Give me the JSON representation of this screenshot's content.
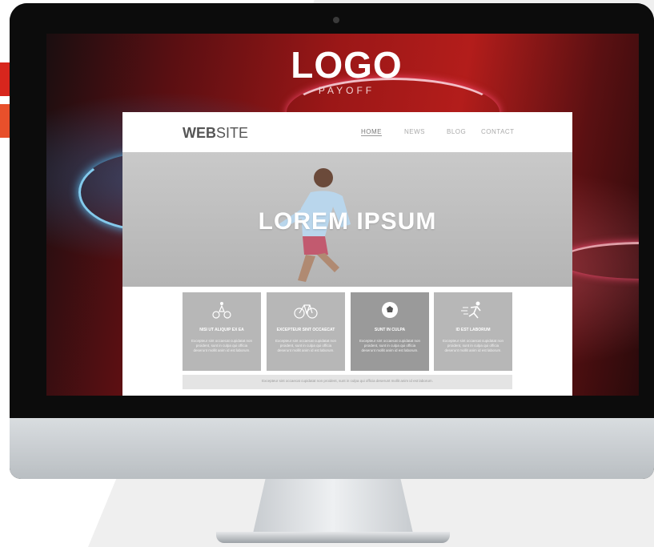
{
  "colors": {
    "accent_red": "#d7261d",
    "accent_orange": "#e8502b",
    "screen_red": "#b31d1b",
    "tile_grey": "#b7b7b7",
    "tile_dark": "#9a9a9a"
  },
  "screen": {
    "logo": "LOGO",
    "payoff": "PAYOFF"
  },
  "site": {
    "brand_bold": "WEB",
    "brand_light": "SITE",
    "nav": [
      "HOME",
      "NEWS",
      "BLOG",
      "CONTACT"
    ],
    "hero_title": "LOREM IPSUM",
    "tiles": [
      {
        "icon": "cycling-sign-icon",
        "title": "NISI UT ALIQUIP EX EA",
        "text": "Excepteur sint occaecat cupidatat non proident, sunt in culpa qui officia deserunt mollit anim id est laborum."
      },
      {
        "icon": "bicycle-icon",
        "title": "EXCEPTEUR SINT OCCAECAT",
        "text": "Excepteur sint occaecat cupidatat non proident, sunt in culpa qui officia deserunt mollit anim id est laborum."
      },
      {
        "icon": "soccer-ball-icon",
        "title": "SUNT IN CULPA",
        "text": "Excepteur sint occaecat cupidatat non proident, sunt in culpa qui officia deserunt mollit anim id est laborum."
      },
      {
        "icon": "running-man-icon",
        "title": "ID EST LABORUM",
        "text": "Excepteur sint occaecat cupidatat non proident, sunt in culpa qui officia deserunt mollit anim id est laborum."
      }
    ],
    "footer_text": "Excepteur sint occaecat cupidatat non proident, sunt in culpa qui officia deserunt mollit anim id est laborum."
  }
}
